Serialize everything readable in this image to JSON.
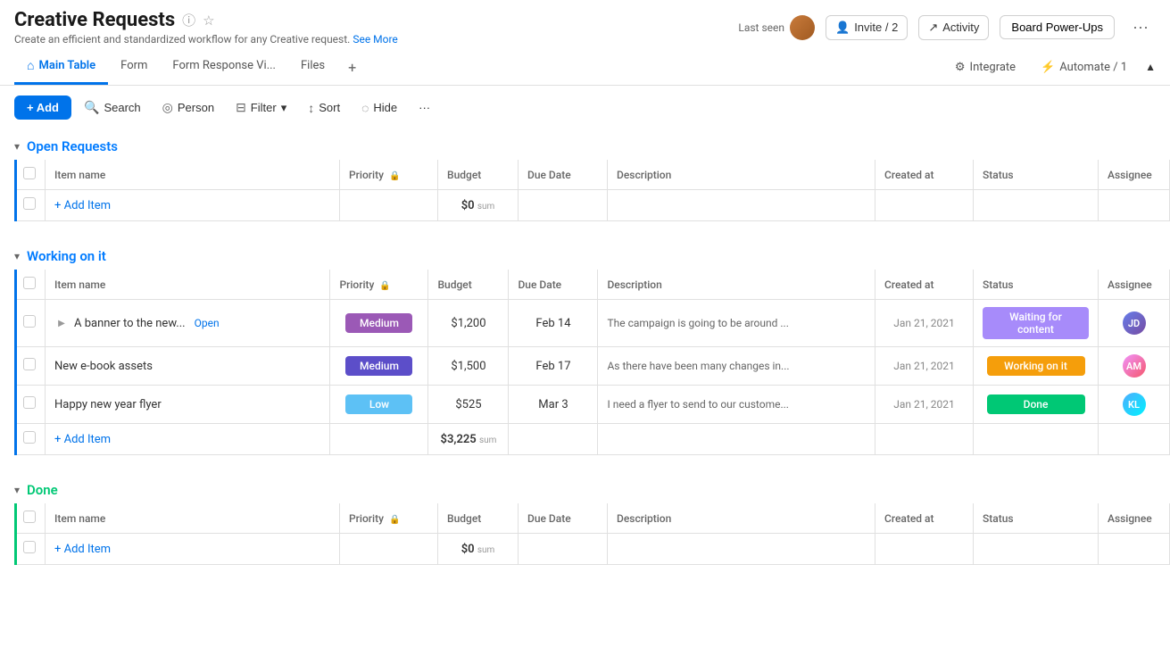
{
  "header": {
    "title": "Creative Requests",
    "subtitle": "Create an efficient and standardized workflow for any Creative request.",
    "subtitle_link": "See More",
    "last_seen_label": "Last seen",
    "invite_label": "Invite / 2",
    "activity_label": "Activity",
    "board_power_ups_label": "Board Power-Ups"
  },
  "tabs": [
    {
      "id": "main-table",
      "label": "Main Table",
      "icon": "🏠",
      "active": true
    },
    {
      "id": "form",
      "label": "Form",
      "active": false
    },
    {
      "id": "form-response",
      "label": "Form Response Vi...",
      "active": false
    },
    {
      "id": "files",
      "label": "Files",
      "active": false
    }
  ],
  "tabs_right": {
    "integrate_label": "Integrate",
    "automate_label": "Automate / 1"
  },
  "toolbar": {
    "add_label": "+ Add",
    "search_label": "Search",
    "person_label": "Person",
    "filter_label": "Filter",
    "sort_label": "Sort",
    "hide_label": "Hide"
  },
  "columns": {
    "item_name": "Item name",
    "priority": "Priority",
    "budget": "Budget",
    "due_date": "Due Date",
    "description": "Description",
    "created_at": "Created at",
    "status": "Status",
    "assignee": "Assignee"
  },
  "sections": [
    {
      "id": "open-requests",
      "title": "Open Requests",
      "color": "blue",
      "collapsed": false,
      "items": [],
      "sum": "$0"
    },
    {
      "id": "working-on-it",
      "title": "Working on it",
      "color": "blue",
      "collapsed": false,
      "items": [
        {
          "name": "A banner to the new...",
          "name_suffix": "Open",
          "priority": "Medium",
          "priority_class": "medium-purple",
          "budget": "$1,200",
          "due_date": "Feb 14",
          "description": "The campaign is going to be around ...",
          "created_at": "Jan 21, 2021",
          "status": "Waiting for content",
          "status_class": "waiting",
          "assignee_class": "av1",
          "assignee_initials": "JD",
          "expanded": false
        },
        {
          "name": "New e-book assets",
          "priority": "Medium",
          "priority_class": "medium-dark",
          "budget": "$1,500",
          "due_date": "Feb 17",
          "description": "As there have been many changes in...",
          "created_at": "Jan 21, 2021",
          "status": "Working on it",
          "status_class": "working",
          "assignee_class": "av2",
          "assignee_initials": "AM"
        },
        {
          "name": "Happy new year flyer",
          "priority": "Low",
          "priority_class": "low",
          "budget": "$525",
          "due_date": "Mar 3",
          "description": "I need a flyer to send to our custome...",
          "created_at": "Jan 21, 2021",
          "status": "Done",
          "status_class": "done",
          "assignee_class": "av3",
          "assignee_initials": "KL"
        }
      ],
      "sum": "$3,225"
    },
    {
      "id": "done",
      "title": "Done",
      "color": "green",
      "collapsed": false,
      "items": [],
      "sum": "$0"
    }
  ],
  "add_item_label": "+ Add Item"
}
